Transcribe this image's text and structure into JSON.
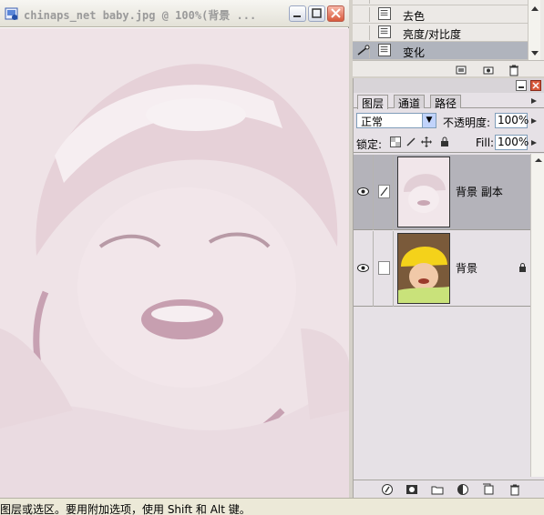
{
  "document": {
    "title": "chinaps_net baby.jpg @ 100%(背景 ..."
  },
  "history": {
    "items": [
      {
        "label": "去色",
        "selected": false
      },
      {
        "label": "亮度/对比度",
        "selected": false
      },
      {
        "label": "变化",
        "selected": true
      }
    ]
  },
  "layers_panel": {
    "tabs": [
      {
        "label": "图层",
        "active": true
      },
      {
        "label": "通道",
        "active": false
      },
      {
        "label": "路径",
        "active": false
      }
    ],
    "blend_mode": "正常",
    "opacity_label": "不透明度:",
    "opacity_value": "100%",
    "lock_label": "锁定:",
    "fill_label": "Fill:",
    "fill_value": "100%",
    "layers": [
      {
        "name": "背景 副本",
        "selected": true,
        "visible": true,
        "locked": false
      },
      {
        "name": "背景",
        "selected": false,
        "visible": true,
        "locked": true
      }
    ]
  },
  "status": {
    "text": "图层或选区。要用附加选项，使用 Shift 和 Alt 键。"
  },
  "colors": {
    "selection": "#b4b3ba",
    "tint": "#f0e4e8",
    "window_close": "#d85a3c"
  }
}
